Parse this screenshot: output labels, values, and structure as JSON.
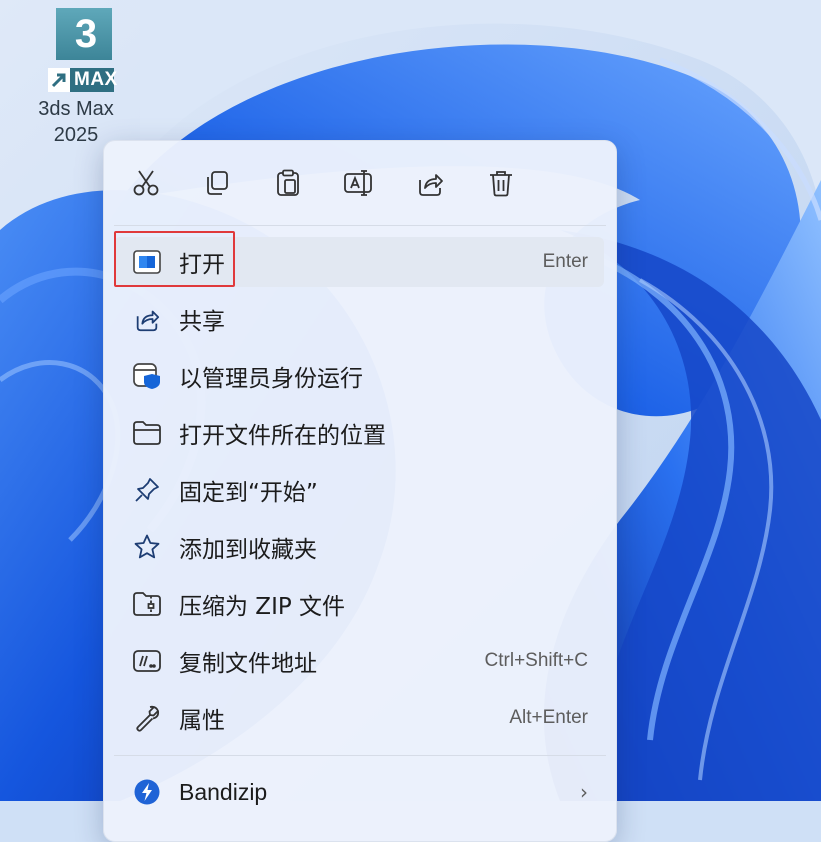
{
  "desktop_icon": {
    "number": "3",
    "badge": "MAX",
    "label_line1": "3ds Max",
    "label_line2": "2025"
  },
  "toolbar": {
    "buttons": [
      "cut-icon",
      "copy-icon",
      "paste-icon",
      "rename-icon",
      "share-icon",
      "delete-icon"
    ]
  },
  "menu": {
    "items": [
      {
        "label": "打开",
        "shortcut": "Enter",
        "icon": "app-window-icon"
      },
      {
        "label": "共享",
        "shortcut": "",
        "icon": "share-icon"
      },
      {
        "label": "以管理员身份运行",
        "shortcut": "",
        "icon": "shield-window-icon"
      },
      {
        "label": "打开文件所在的位置",
        "shortcut": "",
        "icon": "folder-icon"
      },
      {
        "label": "固定到“开始”",
        "shortcut": "",
        "icon": "pin-icon"
      },
      {
        "label": "添加到收藏夹",
        "shortcut": "",
        "icon": "star-icon"
      },
      {
        "label": "压缩为 ZIP 文件",
        "shortcut": "",
        "icon": "zip-folder-icon"
      },
      {
        "label": "复制文件地址",
        "shortcut": "Ctrl+Shift+C",
        "icon": "copy-path-icon"
      },
      {
        "label": "属性",
        "shortcut": "Alt+Enter",
        "icon": "wrench-icon"
      }
    ],
    "submenu_item": {
      "label": "Bandizip",
      "chevron": "›",
      "icon": "bandizip-icon"
    }
  },
  "colors": {
    "wallpaper_blue": "#1a5fe0",
    "highlight_red": "#e0393b",
    "shield_blue": "#1565d8"
  }
}
